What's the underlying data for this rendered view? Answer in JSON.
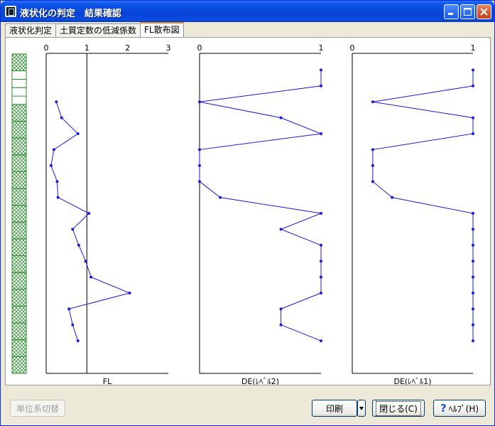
{
  "window": {
    "title": "液状化の判定　結果確認",
    "minimize_icon": "minimize-icon",
    "maximize_icon": "maximize-icon",
    "close_icon": "close-icon"
  },
  "tabs": [
    {
      "label": "液状化判定",
      "active": false
    },
    {
      "label": "土質定数の低減係数",
      "active": false
    },
    {
      "label": "FL散布図",
      "active": true
    }
  ],
  "footer": {
    "units_button": "単位系切替",
    "print_button": "印刷",
    "close_button": "閉じる(C)",
    "help_button": "ﾍﾙﾌﾟ(H)"
  },
  "colors": {
    "series": "#1a1ae0",
    "soil_green": "#2e8b2e"
  },
  "chart_data": [
    {
      "type": "line",
      "title": "",
      "xlabel": "FL",
      "ylabel": "",
      "xlim": [
        0,
        3
      ],
      "xticks": [
        "0",
        "1",
        "2",
        "3"
      ],
      "reference_x": 1,
      "y_depth_index": [
        3,
        4,
        5,
        6,
        7,
        8,
        9,
        10,
        11,
        12,
        13,
        14,
        15,
        16,
        17,
        18
      ],
      "x": [
        0.25,
        0.38,
        0.78,
        0.19,
        0.12,
        0.27,
        0.29,
        1.05,
        0.65,
        0.8,
        0.97,
        1.1,
        2.05,
        0.56,
        0.65,
        0.78
      ]
    },
    {
      "type": "line",
      "title": "",
      "xlabel": "DE(ﾚﾍﾞﾙ2)",
      "ylabel": "",
      "xlim": [
        0,
        1
      ],
      "xticks": [
        "0",
        "1"
      ],
      "y_depth_index": [
        1,
        2,
        3,
        4,
        5,
        6,
        7,
        8,
        9,
        10,
        11,
        12,
        13,
        14,
        15,
        16,
        17,
        18
      ],
      "x": [
        1,
        1,
        0,
        0.67,
        1,
        0,
        0,
        0,
        0.17,
        1,
        0.67,
        1,
        1,
        1,
        1,
        0.67,
        0.67,
        1
      ]
    },
    {
      "type": "line",
      "title": "",
      "xlabel": "DE(ﾚﾍﾞﾙ1)",
      "ylabel": "",
      "xlim": [
        0,
        1
      ],
      "xticks": [
        "0",
        "1"
      ],
      "y_depth_index": [
        1,
        2,
        3,
        4,
        5,
        6,
        7,
        8,
        9,
        10,
        11,
        12,
        13,
        14,
        15,
        16,
        17,
        18
      ],
      "x": [
        1,
        1,
        0.17,
        1,
        1,
        0.17,
        0.17,
        0.17,
        0.33,
        1,
        1,
        1,
        1,
        1,
        1,
        1,
        1,
        1
      ]
    }
  ],
  "soil_column": {
    "layers": [
      {
        "pattern": "crosshatch",
        "count": 1
      },
      {
        "pattern": "lines",
        "count": 2
      },
      {
        "pattern": "crosshatch",
        "count": 16
      }
    ]
  }
}
